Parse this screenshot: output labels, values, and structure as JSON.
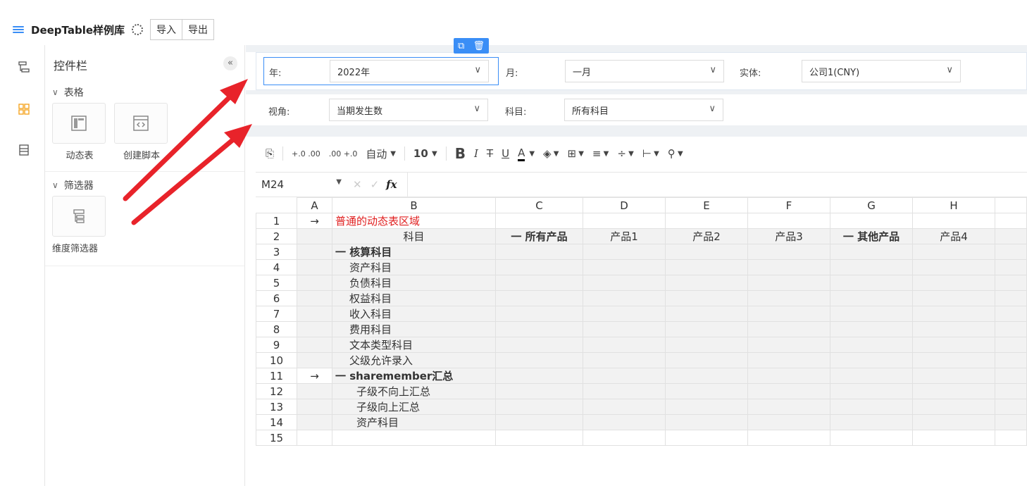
{
  "header": {
    "app_title": "DeepTable样例库",
    "import_label": "导入",
    "export_label": "导出"
  },
  "panel": {
    "title": "控件栏",
    "collapse_glyph": "«",
    "section_table": "表格",
    "widget_dynamic": "动态表",
    "widget_script": "创建脚本",
    "section_filter": "筛选器",
    "widget_dim_filter": "维度筛选器"
  },
  "filters": {
    "year_label": "年:",
    "year_value": "2022年",
    "month_label": "月:",
    "month_value": "一月",
    "entity_label": "实体:",
    "entity_value": "公司1(CNY)",
    "view_label": "视角:",
    "view_value": "当期发生数",
    "account_label": "科目:",
    "account_value": "所有科目"
  },
  "toolbar": {
    "dec_inc": "+.0 .00",
    "dec_dec": ".00 +.0",
    "format": "自动",
    "font_size": "10",
    "bold": "B",
    "italic": "I",
    "strike": "T",
    "underline": "U",
    "font_color": "A"
  },
  "formula": {
    "cell_ref": "M24",
    "fx": "fx"
  },
  "sheet": {
    "columns": [
      "A",
      "B",
      "C",
      "D",
      "E",
      "F",
      "G",
      "H"
    ],
    "rows": [
      {
        "n": "1",
        "a": "→",
        "b": "普通的动态表区域",
        "c": "",
        "d": "",
        "e": "",
        "f": "",
        "g": "",
        "h": ""
      },
      {
        "n": "2",
        "a": "",
        "b": "科目",
        "c": "一 所有产品",
        "d": "产品1",
        "e": "产品2",
        "f": "产品3",
        "g": "一 其他产品",
        "h": "产品4"
      },
      {
        "n": "3",
        "a": "",
        "b": "一 核算科目"
      },
      {
        "n": "4",
        "a": "",
        "b": "资产科目"
      },
      {
        "n": "5",
        "a": "",
        "b": "负债科目"
      },
      {
        "n": "6",
        "a": "",
        "b": "权益科目"
      },
      {
        "n": "7",
        "a": "",
        "b": "收入科目"
      },
      {
        "n": "8",
        "a": "",
        "b": "费用科目"
      },
      {
        "n": "9",
        "a": "",
        "b": "文本类型科目"
      },
      {
        "n": "10",
        "a": "",
        "b": "父级允许录入"
      },
      {
        "n": "11",
        "a": "→",
        "b": "一 sharemember汇总"
      },
      {
        "n": "12",
        "a": "",
        "b": "子级不向上汇总"
      },
      {
        "n": "13",
        "a": "",
        "b": "子级向上汇总"
      },
      {
        "n": "14",
        "a": "",
        "b": "资产科目"
      },
      {
        "n": "15",
        "a": "",
        "b": ""
      }
    ]
  },
  "colors": {
    "accent": "#3a8ef6",
    "arrow": "#e8232a",
    "red_text": "#e02020"
  }
}
